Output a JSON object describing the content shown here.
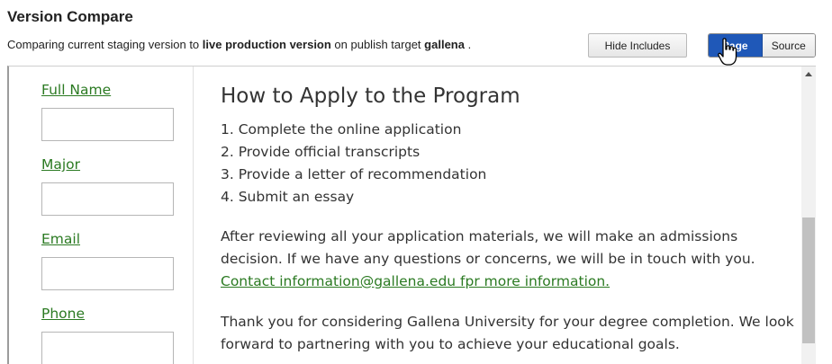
{
  "header": {
    "title": "Version Compare",
    "subtitle_pre": "Comparing current staging version to ",
    "subtitle_bold1": "live production version",
    "subtitle_mid": " on publish target ",
    "subtitle_bold2": "gallena",
    "subtitle_post": " ."
  },
  "toolbar": {
    "hide_includes_label": "Hide Includes",
    "view_modes": [
      "Page",
      "Source"
    ],
    "active_view": "Page"
  },
  "form": {
    "fields": [
      {
        "label": "Full Name",
        "value": ""
      },
      {
        "label": "Major",
        "value": ""
      },
      {
        "label": "Email",
        "value": ""
      },
      {
        "label": "Phone",
        "value": ""
      }
    ]
  },
  "content": {
    "heading": "How to Apply to the Program",
    "steps": [
      "1. Complete the online application",
      "2. Provide official transcripts",
      "3. Provide a letter of recommendation",
      "4. Submit an essay"
    ],
    "paragraph1_text": "After reviewing all your application materials, we will make an admissions decision. If we have any questions or concerns, we will be in touch with you.",
    "paragraph1_link": "Contact information@gallena.edu fpr more information.",
    "paragraph2": "Thank you for considering Gallena University for your degree completion. We look forward to partnering with you to achieve your educational goals."
  },
  "colors": {
    "accent": "#1f58b8",
    "link": "#2b7a22",
    "text": "#333333"
  },
  "icons": {
    "cursor": "hand-pointer-icon",
    "scroll_up": "chevron-up-icon"
  }
}
